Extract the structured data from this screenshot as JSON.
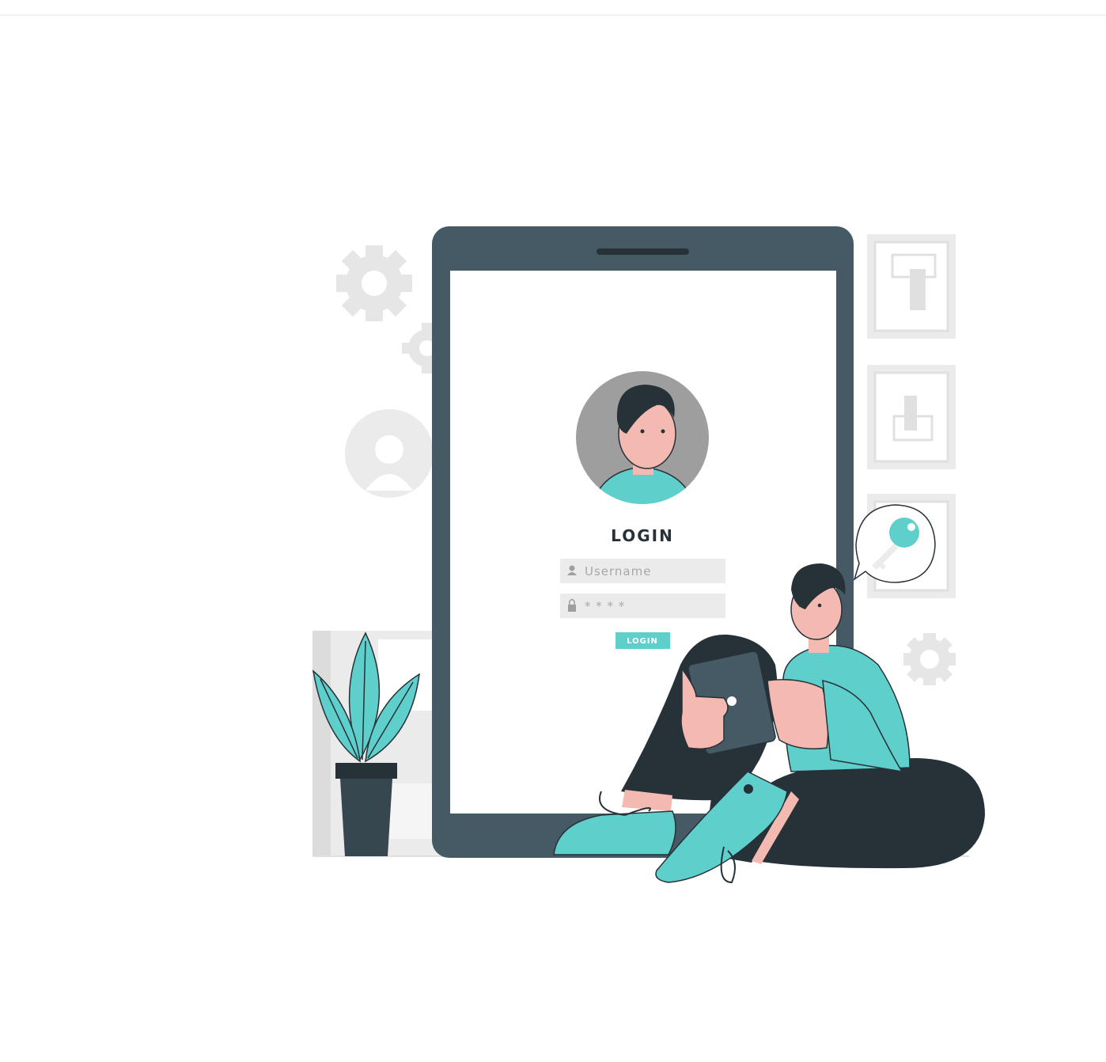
{
  "login_screen": {
    "title": "LOGIN",
    "username_placeholder": "Username",
    "password_mask": "* * * *",
    "button_label": "LOGIN"
  },
  "colors": {
    "accent": "#5FCFCB",
    "device": "#455A64",
    "dark": "#263238",
    "skin": "#F4B9B0",
    "light_gray": "#EBEBEB"
  },
  "icons": [
    "gear-icon",
    "user-icon",
    "lock-icon",
    "key-icon"
  ]
}
